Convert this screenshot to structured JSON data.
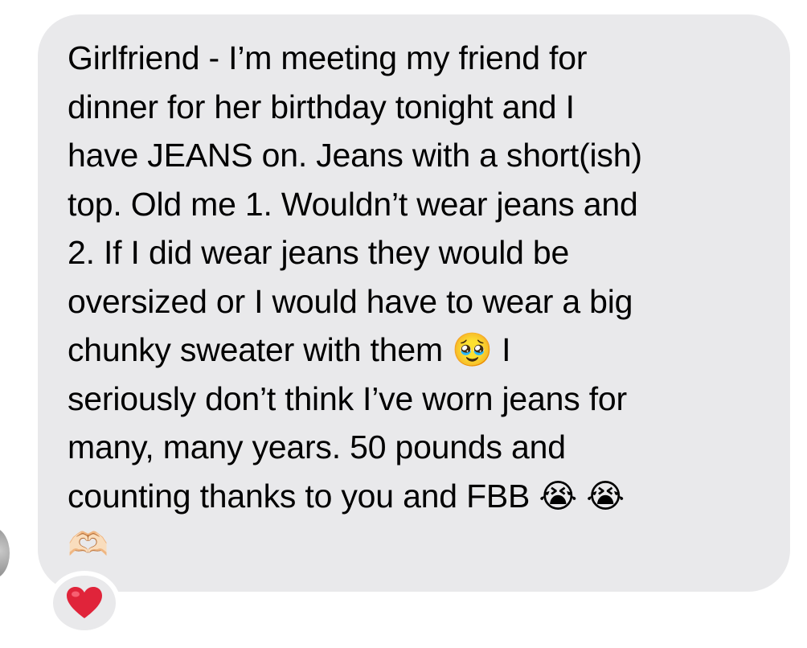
{
  "message": {
    "lines": [
      "Girlfriend - I’m meeting my friend for",
      "dinner for her birthday tonight and I",
      "have JEANS on. Jeans with a short(ish)",
      "top. Old me 1. Wouldn’t wear jeans and",
      "2. If I did wear jeans they would be",
      "oversized or I would have to wear a big",
      "chunky sweater with them 🥹 I",
      "seriously don’t think I’ve worn jeans for",
      "many, many years. 50 pounds and",
      "counting thanks to you and FBB 😭 😭",
      "🫶🏻"
    ]
  },
  "reaction": {
    "icon": "heart-icon",
    "color": "#e0243a"
  },
  "bubble_color": "#e9e9eb"
}
